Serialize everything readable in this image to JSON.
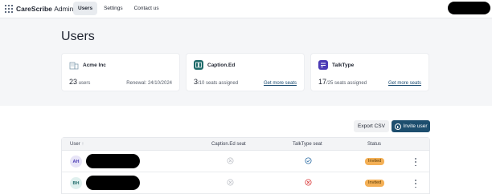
{
  "app": {
    "brand_bold": "CareScribe",
    "brand_light": "Admin"
  },
  "nav": {
    "items": [
      {
        "label": "Users",
        "active": true
      },
      {
        "label": "Settings",
        "active": false
      },
      {
        "label": "Contact us",
        "active": false
      }
    ]
  },
  "page": {
    "title": "Users"
  },
  "cards": {
    "org": {
      "name": "Acme Inc",
      "count": "23",
      "count_suffix": "users",
      "renewal": "Renewal: 24/10/2024",
      "icon": "building-icon"
    },
    "caption": {
      "name": "Caption.Ed",
      "count": "3",
      "count_suffix": "/10 seats assigned",
      "link": "Get more seats",
      "icon": "caption-ed-logo",
      "color": "#1f6b6a"
    },
    "talktype": {
      "name": "TalkType",
      "count": "17",
      "count_suffix": "/25 seats assigned",
      "link": "Get more seats",
      "icon": "talktype-logo",
      "color": "#4b3bb5"
    }
  },
  "actions": {
    "export": "Export CSV",
    "invite": "Invite user"
  },
  "table": {
    "headers": {
      "user": "User",
      "caption_seat": "Caption.Ed seat",
      "talktype_seat": "TalkType seat",
      "status": "Status"
    },
    "rows": [
      {
        "initials": "AH",
        "caption_seat": "none",
        "talktype_seat": "assigned",
        "status": "Invited"
      },
      {
        "initials": "BH",
        "caption_seat": "none",
        "talktype_seat": "denied",
        "status": "Invited"
      }
    ]
  },
  "colors": {
    "primary": "#1d4e6e",
    "badge": "#f4b056",
    "check": "#2e6da4",
    "cross": "#d93a3a"
  }
}
